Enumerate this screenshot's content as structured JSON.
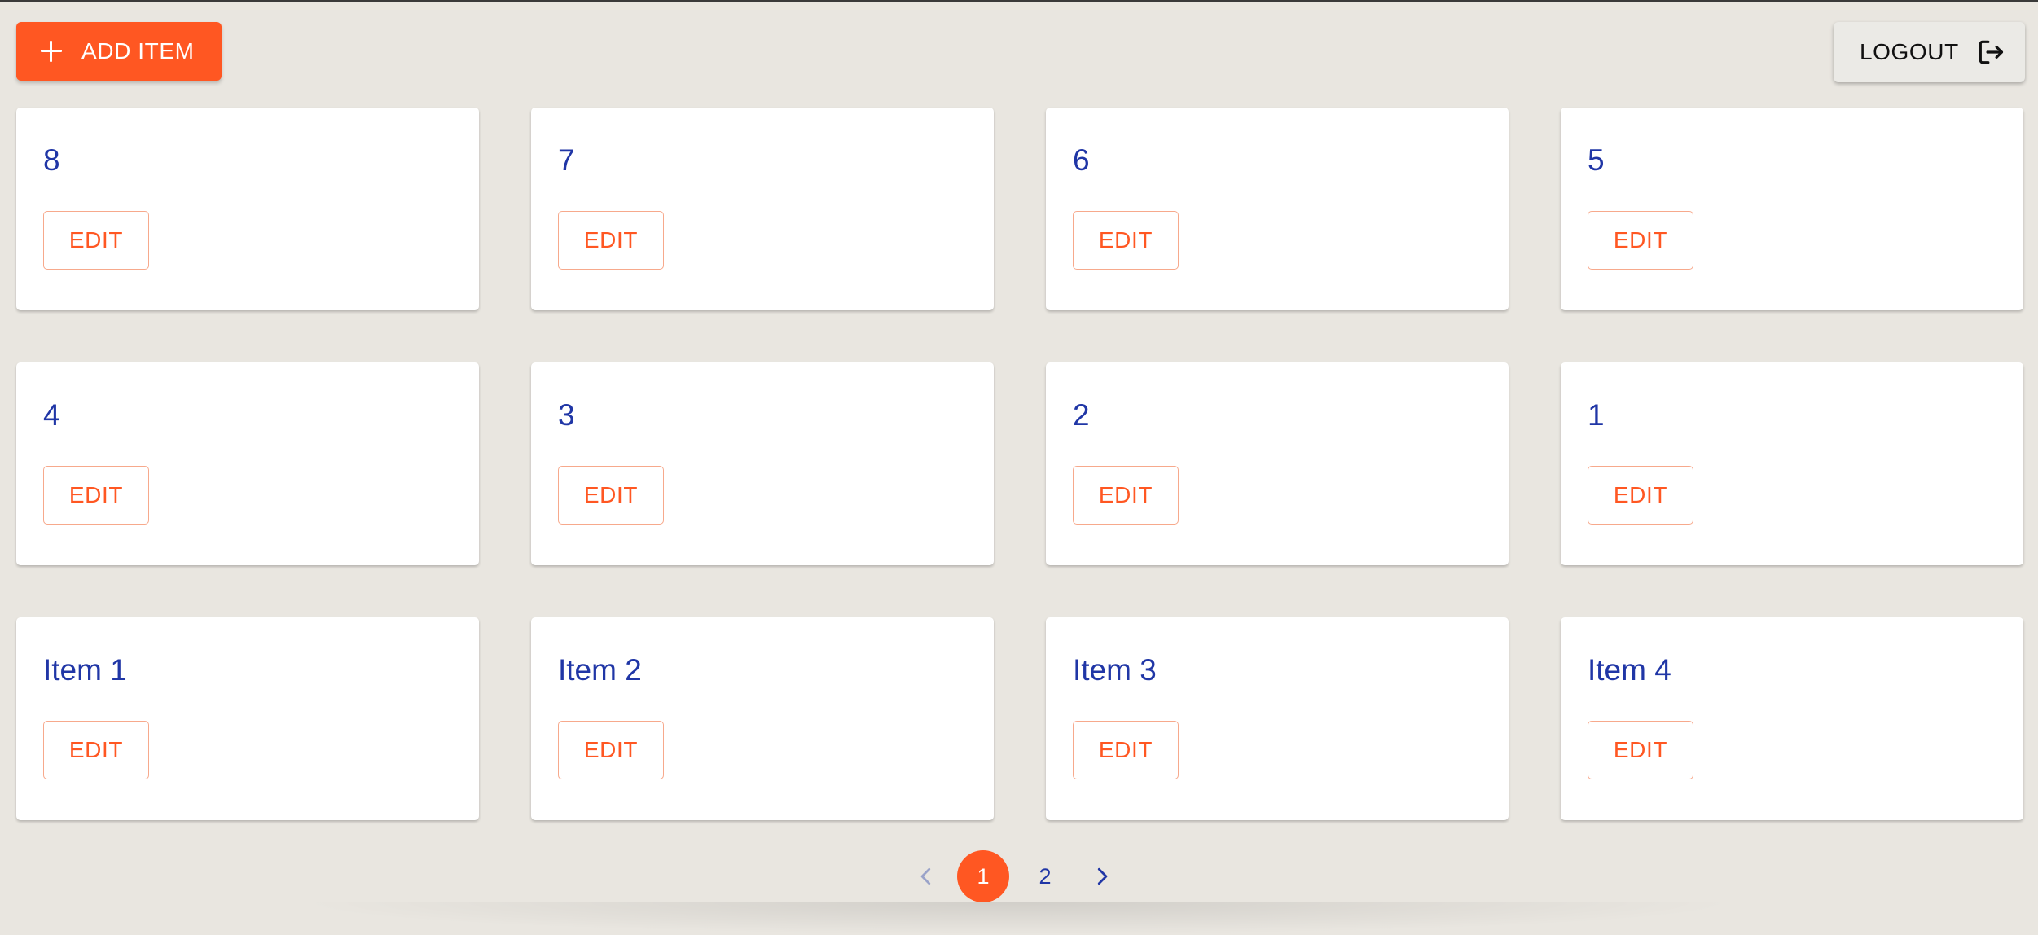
{
  "toolbar": {
    "add_label": "ADD ITEM",
    "logout_label": "LOGOUT"
  },
  "cards": [
    {
      "title": "8",
      "edit_label": "EDIT"
    },
    {
      "title": "7",
      "edit_label": "EDIT"
    },
    {
      "title": "6",
      "edit_label": "EDIT"
    },
    {
      "title": "5",
      "edit_label": "EDIT"
    },
    {
      "title": "4",
      "edit_label": "EDIT"
    },
    {
      "title": "3",
      "edit_label": "EDIT"
    },
    {
      "title": "2",
      "edit_label": "EDIT"
    },
    {
      "title": "1",
      "edit_label": "EDIT"
    },
    {
      "title": "Item 1",
      "edit_label": "EDIT"
    },
    {
      "title": "Item 2",
      "edit_label": "EDIT"
    },
    {
      "title": "Item 3",
      "edit_label": "EDIT"
    },
    {
      "title": "Item 4",
      "edit_label": "EDIT"
    }
  ],
  "pagination": {
    "pages": [
      "1",
      "2"
    ],
    "current_page": "1"
  },
  "colors": {
    "accent": "#ff5722",
    "title_text": "#2036a6",
    "background": "#e9e6e0"
  },
  "icons": {
    "add": "plus-icon",
    "logout": "logout-icon",
    "prev": "chevron-left-icon",
    "next": "chevron-right-icon"
  }
}
